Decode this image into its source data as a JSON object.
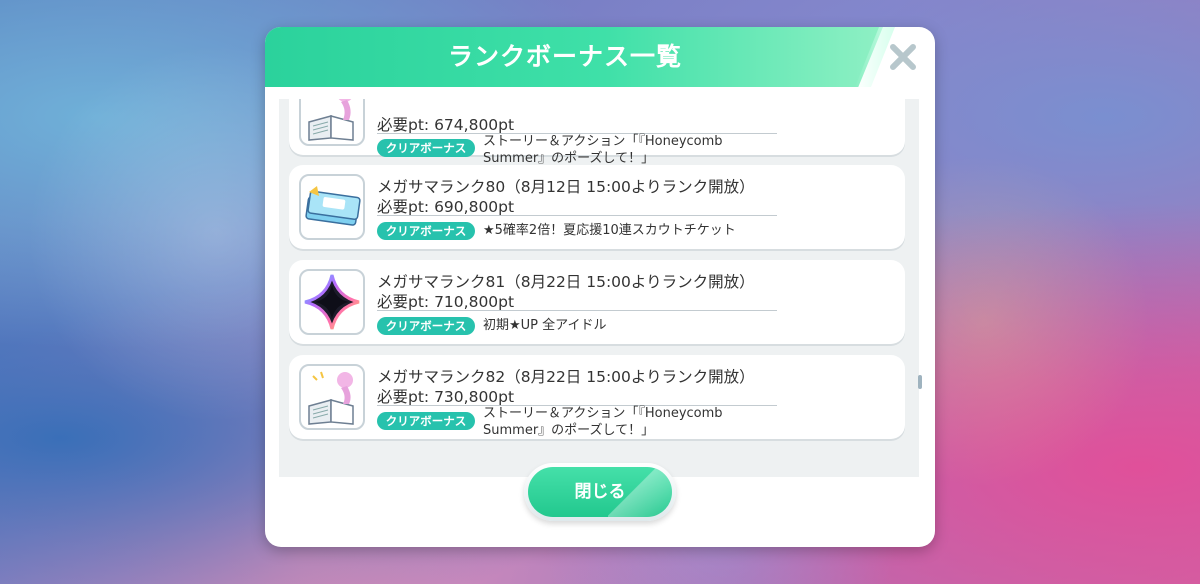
{
  "dialog": {
    "title": "ランクボーナス一覧",
    "close_button_label": "閉じる",
    "close_icon": "close-icon"
  },
  "badge_label": "クリアボーナス",
  "items": [
    {
      "title": "",
      "required_pt": "必要pt: 674,800pt",
      "bonus_line1": "ストーリー＆アクション「『Honeycomb",
      "bonus_line2": "Summer』のポーズして！」",
      "icon": "story-book-icon"
    },
    {
      "title": "メガサマランク80（8月12日 15:00よりランク開放）",
      "required_pt": "必要pt: 690,800pt",
      "bonus_line1": "★5確率2倍！夏応援10連スカウトチケット",
      "bonus_line2": "",
      "icon": "scout-ticket-icon"
    },
    {
      "title": "メガサマランク81（8月22日 15:00よりランク開放）",
      "required_pt": "必要pt: 710,800pt",
      "bonus_line1": "初期★UP 全アイドル",
      "bonus_line2": "",
      "icon": "rainbow-star-icon"
    },
    {
      "title": "メガサマランク82（8月22日 15:00よりランク開放）",
      "required_pt": "必要pt: 730,800pt",
      "bonus_line1": "ストーリー＆アクション「『Honeycomb",
      "bonus_line2": "Summer』のポーズして！」",
      "icon": "story-book-icon"
    }
  ]
}
